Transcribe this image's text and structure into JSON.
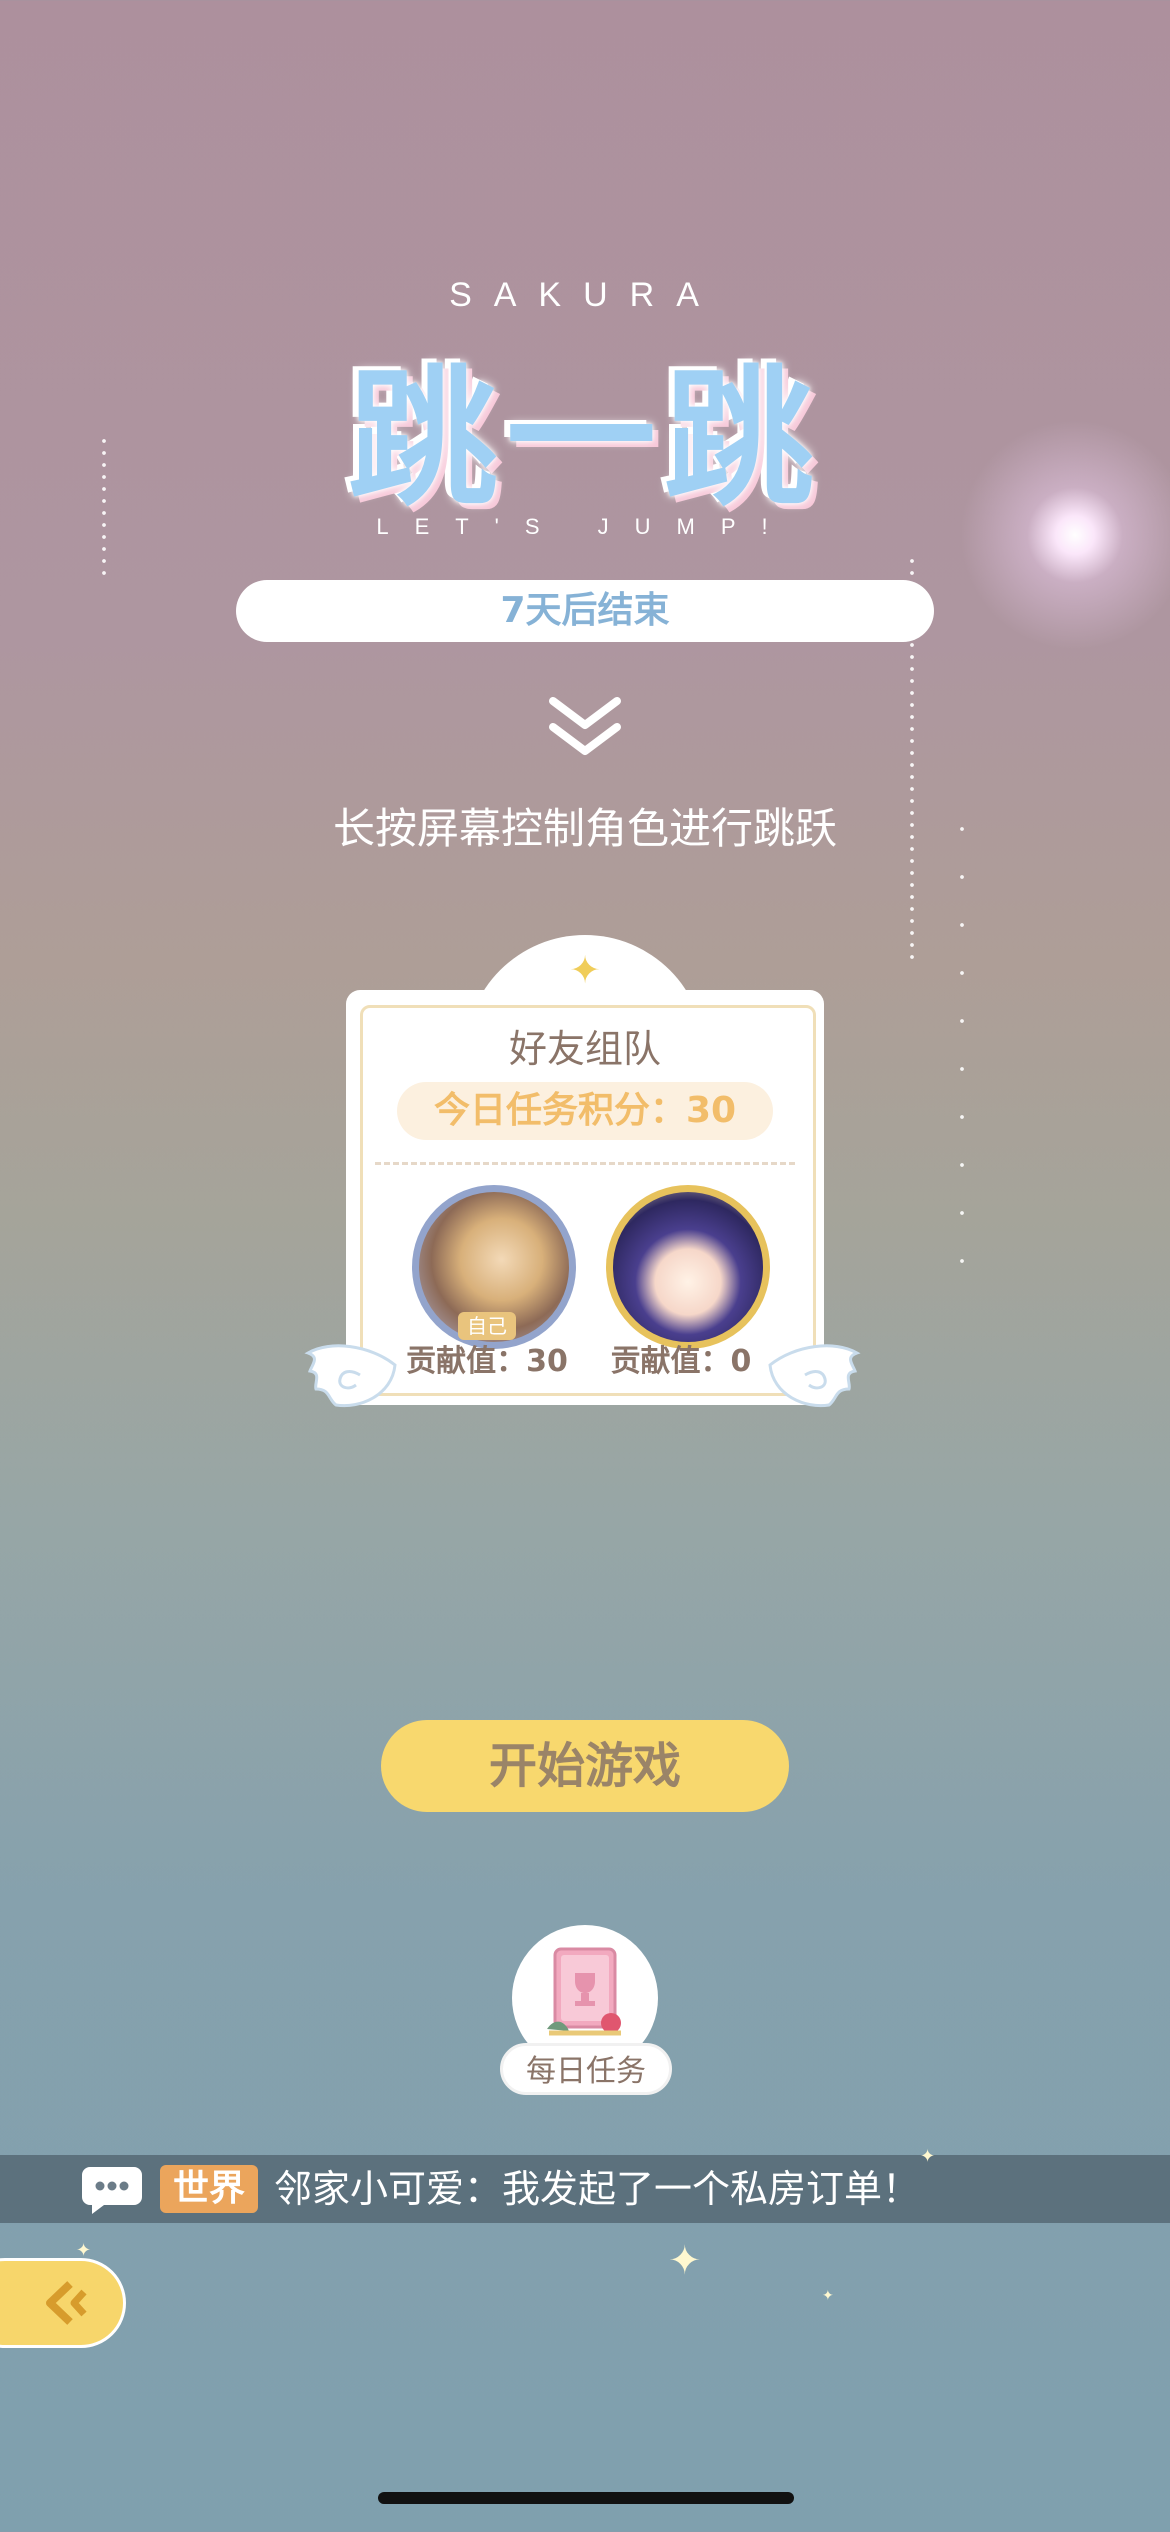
{
  "logo": {
    "sakura": "SAKURA",
    "title": "跳一跳",
    "subtitle": "LET'S JUMP!"
  },
  "event": {
    "days_left": "7天后结束"
  },
  "hint": "长按屏幕控制角色进行跳跃",
  "team": {
    "title": "好友组队",
    "score": "今日任务积分：30",
    "self_tag": "自己",
    "members": [
      {
        "contribution": "贡献值：30"
      },
      {
        "contribution": "贡献值：0"
      }
    ]
  },
  "start_button": "开始游戏",
  "daily_task": {
    "label": "每日任务"
  },
  "chat": {
    "channel": "世界",
    "message": "邻家小可爱：我发起了一个私房订单！"
  },
  "colors": {
    "accent": "#f8d86e",
    "pill_text": "#86b2d6",
    "world_tag": "#eba55c"
  },
  "icons": [
    "chevron-down-icon",
    "star-icon",
    "wing-icon",
    "book-trophy-icon",
    "chat-bubble-icon",
    "back-arrow-icon",
    "sparkle-icon"
  ]
}
